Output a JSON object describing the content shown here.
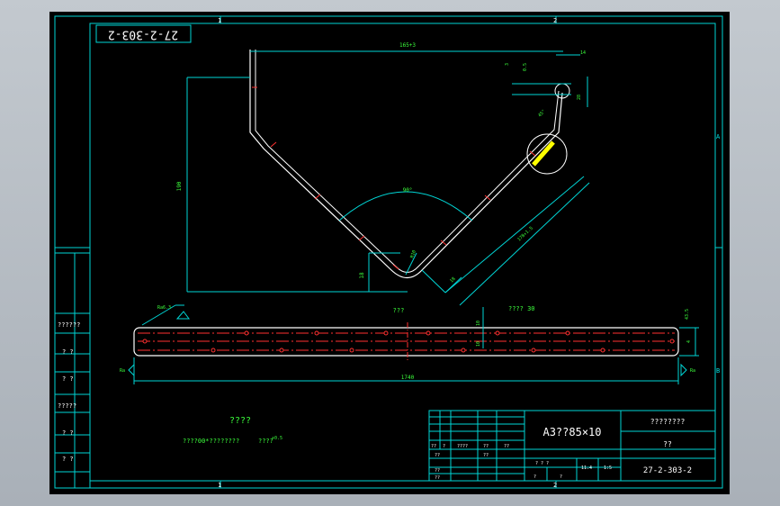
{
  "drawing_number_rotated": "27-2-303-2",
  "zone_labels": {
    "top": [
      "1",
      "2"
    ],
    "bottom": [
      "1",
      "2"
    ],
    "right": [
      "A",
      "B"
    ]
  },
  "top_view_dims": {
    "top_width": "165+3",
    "height": "190",
    "angle": "90°",
    "small_height": "18",
    "bend_radius": "R10",
    "inner_offset": "18",
    "slant_length": "178+1.5",
    "detail_w": "14",
    "detail_h": "28",
    "detail_dim": "3",
    "detail_angle": "45°",
    "detail_small": "0.5"
  },
  "plate": {
    "title": "???",
    "spacing_note": "???? 30",
    "length": "1740",
    "height": "43.5",
    "small_dims": [
      "4",
      "10",
      "10"
    ],
    "weld_tag": "Ra6.3",
    "edge_mark_left": "Ra",
    "edge_mark_right": "Ra"
  },
  "notes": {
    "heading": "????",
    "line1": "????00*????????",
    "line2": "????",
    "line2_suffix": "+0.5"
  },
  "left_strip": {
    "cells": [
      "??????",
      "? ?",
      "? ?",
      "?????",
      "? ?",
      "? ?"
    ]
  },
  "title_block": {
    "material": "A3??85×10",
    "part_name": "????????",
    "scale_label": "??",
    "drawing_no": "27-2-303-2",
    "row_labels": [
      "??",
      "?",
      "????",
      "??",
      "??"
    ],
    "left_cells": [
      "??",
      "??",
      "??",
      "??"
    ],
    "mid_labels": [
      "? ? ?",
      "?",
      "?"
    ],
    "weight": "11.4",
    "scale": "1:5"
  }
}
